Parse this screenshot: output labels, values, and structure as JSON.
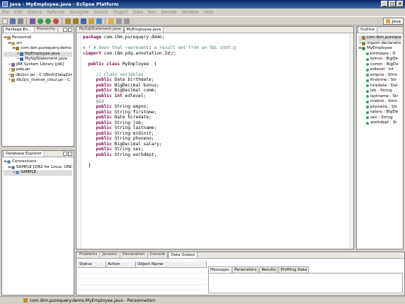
{
  "window": {
    "title": "Java - MyEmployee.java - Eclipse Platform"
  },
  "menu": [
    "File",
    "Edit",
    "Source",
    "Refactor",
    "Navigate",
    "Search",
    "Project",
    "Data",
    "Run",
    "Sample",
    "Window",
    "Help"
  ],
  "perspective": {
    "label": "Java"
  },
  "package_explorer": {
    "tabs": [
      "Package Ex...",
      "Hierarchy"
    ],
    "tree": [
      {
        "label": "Personnel",
        "indent": 0,
        "icon": "project-icon",
        "expander": "▬"
      },
      {
        "label": "src",
        "indent": 1,
        "icon": "source-folder-icon",
        "expander": "▬"
      },
      {
        "label": "com.ibm.purequery.demo",
        "indent": 2,
        "icon": "package-icon",
        "expander": "▬"
      },
      {
        "label": "MyEmployee.java",
        "indent": 3,
        "icon": "java-file-icon",
        "expander": "+",
        "selected": true
      },
      {
        "label": "MySqlStatement.java",
        "indent": 3,
        "icon": "java-file-icon",
        "expander": "+"
      },
      {
        "label": "JRE System Library [jdk]",
        "indent": 1,
        "icon": "library-icon",
        "expander": "+"
      },
      {
        "label": "pdq.jar",
        "indent": 1,
        "icon": "jar-icon",
        "expander": "+"
      },
      {
        "label": "db2jcc.jar - C:\\Work\\DataZen",
        "indent": 1,
        "icon": "jar-icon",
        "expander": "+"
      },
      {
        "label": "db2jcc_license_cisuz.jar - C",
        "indent": 1,
        "icon": "jar-icon",
        "expander": "+"
      }
    ]
  },
  "database_explorer": {
    "tab": "Database Explorer",
    "tree": [
      {
        "label": "Connections",
        "indent": 0,
        "icon": "database-icon",
        "expander": "▬"
      },
      {
        "label": "SAMPLE [DB2 for Linux, UNIX",
        "indent": 1,
        "icon": "database-icon",
        "expander": "▬"
      },
      {
        "label": "SAMPLE",
        "indent": 2,
        "icon": "database-icon",
        "expander": "+",
        "selected": true
      }
    ]
  },
  "editor": {
    "tabs": [
      "MySqlStatement.java",
      "MyEmployee.java"
    ],
    "lines": [
      [
        {
          "t": "package ",
          "c": "kw"
        },
        {
          "t": "com.ibm.purequery.demo;",
          "c": ""
        }
      ],
      [],
      [
        {
          "t": "⊕",
          "c": "fold"
        },
        {
          "t": " * A bean that represents a result set from an SQL stmt.",
          "c": "cm"
        },
        {
          "t": "▢",
          "c": ""
        }
      ],
      [
        {
          "t": "⊕",
          "c": "fold"
        },
        {
          "t": "import ",
          "c": "kw"
        },
        {
          "t": "com.ibm.pdq.annotation.Id;",
          "c": ""
        },
        {
          "t": "▢",
          "c": ""
        }
      ],
      [],
      [
        {
          "t": "  public class ",
          "c": "kw"
        },
        {
          "t": "MyEmployee  {",
          "c": ""
        }
      ],
      [],
      [
        {
          "t": "     // Class variables",
          "c": "cm"
        }
      ],
      [
        {
          "t": "     public ",
          "c": "kw"
        },
        {
          "t": "Date birthdate;",
          "c": ""
        }
      ],
      [
        {
          "t": "     public ",
          "c": "kw"
        },
        {
          "t": "BigDecimal bonus;",
          "c": ""
        }
      ],
      [
        {
          "t": "     public ",
          "c": "kw"
        },
        {
          "t": "BigDecimal comm;",
          "c": ""
        }
      ],
      [
        {
          "t": "     public int ",
          "c": "kw"
        },
        {
          "t": "edlevel;",
          "c": ""
        }
      ],
      [
        {
          "t": "     @Id",
          "c": "an"
        }
      ],
      [
        {
          "t": "     public ",
          "c": "kw"
        },
        {
          "t": "String empno;",
          "c": ""
        }
      ],
      [
        {
          "t": "     public ",
          "c": "kw"
        },
        {
          "t": "String firstnme;",
          "c": ""
        }
      ],
      [
        {
          "t": "     public ",
          "c": "kw"
        },
        {
          "t": "Date hiredate;",
          "c": ""
        }
      ],
      [
        {
          "t": "     public ",
          "c": "kw"
        },
        {
          "t": "String job;",
          "c": ""
        }
      ],
      [
        {
          "t": "     public ",
          "c": "kw"
        },
        {
          "t": "String lastname;",
          "c": ""
        }
      ],
      [
        {
          "t": "     public ",
          "c": "kw"
        },
        {
          "t": "String midinit;",
          "c": ""
        }
      ],
      [
        {
          "t": "     public ",
          "c": "kw"
        },
        {
          "t": "String phoneno;",
          "c": ""
        }
      ],
      [
        {
          "t": "     public ",
          "c": "kw"
        },
        {
          "t": "BigDecimal salary;",
          "c": ""
        }
      ],
      [
        {
          "t": "     public ",
          "c": "kw"
        },
        {
          "t": "String sex;",
          "c": ""
        }
      ],
      [
        {
          "t": "     public ",
          "c": "kw"
        },
        {
          "t": "String workdept;",
          "c": ""
        }
      ],
      [],
      [
        {
          "t": "  }",
          "c": ""
        }
      ]
    ]
  },
  "outline": {
    "tab": "Outline",
    "tree": [
      {
        "label": "com.ibm.pureque",
        "indent": 0,
        "icon": "package-icon",
        "expander": "",
        "selected": true
      },
      {
        "label": "import declaratio",
        "indent": 0,
        "icon": "import-icon",
        "expander": "+"
      },
      {
        "label": "MyEmployee",
        "indent": 0,
        "icon": "class-icon",
        "expander": "▬"
      },
      {
        "label": "birthdate : D",
        "indent": 1,
        "icon": "field-icon",
        "expander": ""
      },
      {
        "label": "bonus : BigDe",
        "indent": 1,
        "icon": "field-icon",
        "expander": ""
      },
      {
        "label": "comm : BigDe",
        "indent": 1,
        "icon": "field-icon",
        "expander": ""
      },
      {
        "label": "edlevel : int",
        "indent": 1,
        "icon": "field-icon",
        "expander": ""
      },
      {
        "label": "empno : Strin",
        "indent": 1,
        "icon": "field-icon",
        "expander": ""
      },
      {
        "label": "firstnme : Str",
        "indent": 1,
        "icon": "field-icon",
        "expander": ""
      },
      {
        "label": "hiredate : Dat",
        "indent": 1,
        "icon": "field-icon",
        "expander": ""
      },
      {
        "label": "job : String",
        "indent": 1,
        "icon": "field-icon",
        "expander": ""
      },
      {
        "label": "lastname : Str",
        "indent": 1,
        "icon": "field-icon",
        "expander": ""
      },
      {
        "label": "midinit : Strin",
        "indent": 1,
        "icon": "field-icon",
        "expander": ""
      },
      {
        "label": "phoneno : Str",
        "indent": 1,
        "icon": "field-icon",
        "expander": ""
      },
      {
        "label": "salary : BigDe",
        "indent": 1,
        "icon": "field-icon",
        "expander": ""
      },
      {
        "label": "sex : String",
        "indent": 1,
        "icon": "field-icon",
        "expander": ""
      },
      {
        "label": "workdept : St",
        "indent": 1,
        "icon": "field-icon",
        "expander": ""
      }
    ]
  },
  "bottom_panel": {
    "tabs": [
      "Problems",
      "Javadoc",
      "Declaration",
      "Console",
      "Data Output"
    ],
    "columns": [
      "Status",
      "Action",
      "Object Name"
    ],
    "subtabs": [
      "Messages",
      "Parameters",
      "Results",
      "Profiling Data"
    ]
  },
  "status": {
    "text": "com.ibm.purequery.demo.MyEmployee.java - Personnel/src"
  }
}
